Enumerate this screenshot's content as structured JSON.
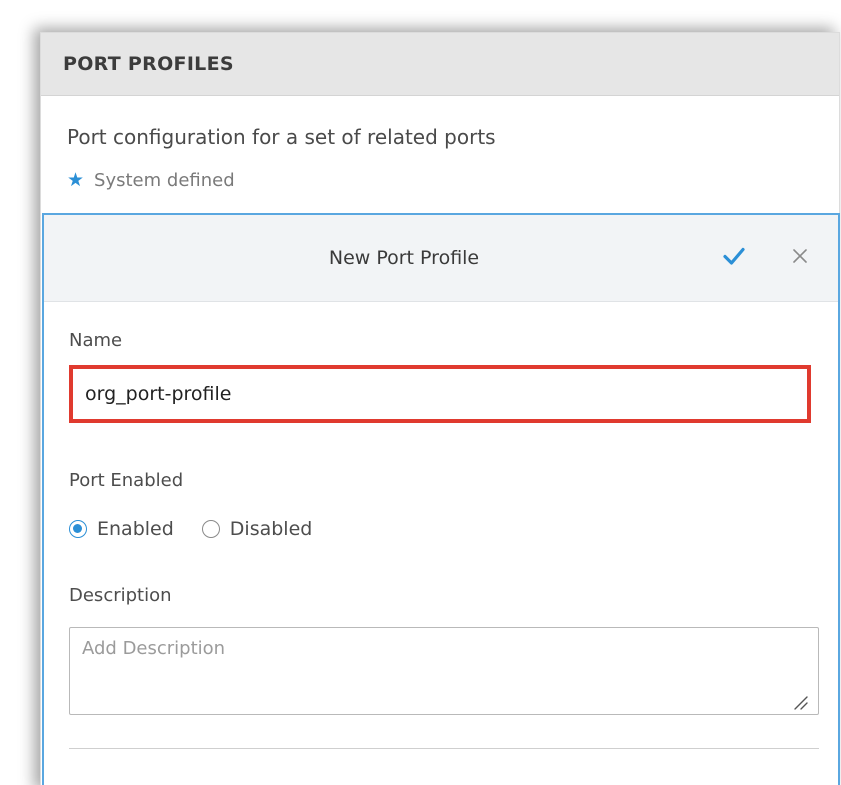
{
  "panel": {
    "title": "PORT PROFILES",
    "description": "Port configuration for a set of related ports",
    "system_defined_label": "System defined",
    "system_defined_icon": "star-icon"
  },
  "editor": {
    "title": "New Port Profile",
    "confirm_icon": "check-icon",
    "close_icon": "close-icon",
    "name": {
      "label": "Name",
      "value": "org_port-profile"
    },
    "port_enabled": {
      "label": "Port Enabled",
      "options": [
        "Enabled",
        "Disabled"
      ],
      "selected": "Enabled"
    },
    "description": {
      "label": "Description",
      "placeholder": "Add Description",
      "value": ""
    }
  },
  "colors": {
    "accent": "#2b8fd6",
    "highlight_box": "#e03a2f",
    "editor_border": "#5aa7e0"
  }
}
